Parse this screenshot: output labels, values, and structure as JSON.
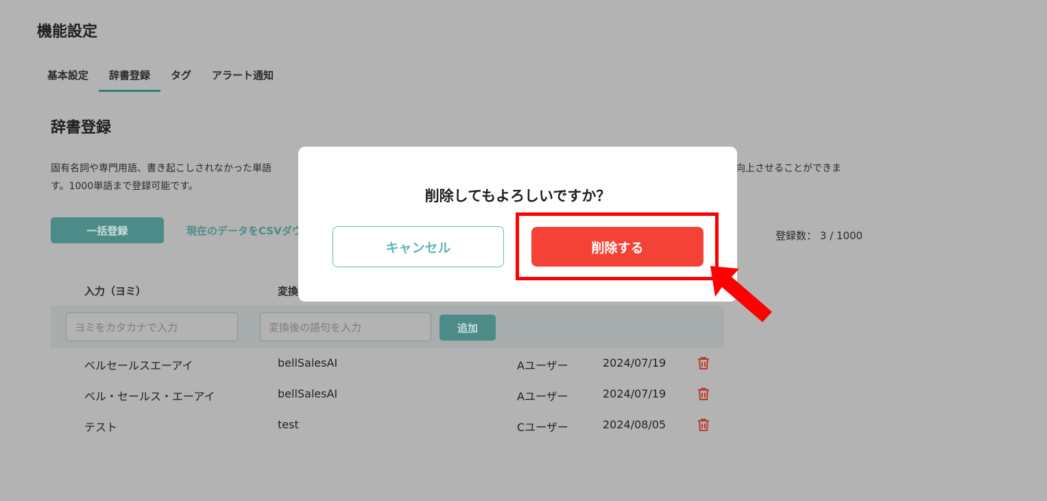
{
  "page": {
    "title": "機能設定"
  },
  "tabs": [
    {
      "label": "基本設定",
      "active": false
    },
    {
      "label": "辞書登録",
      "active": true
    },
    {
      "label": "タグ",
      "active": false
    },
    {
      "label": "アラート通知",
      "active": false
    }
  ],
  "section": {
    "title": "辞書登録",
    "description_line1_left": "固有名詞や専門用語、書き起こしされなかった単語",
    "description_line1_right": "向上させることができま",
    "description_line2": "す。1000単語まで登録可能です。"
  },
  "toolbar": {
    "bulk_label": "一括登録",
    "csv_label": "現在のデータをCSVダウ",
    "count_text": "登録数： 3 / 1000"
  },
  "table": {
    "headers": {
      "yomi": "入力（ヨミ）",
      "converted": "変換"
    },
    "input_row": {
      "yomi_placeholder": "ヨミをカタカナで入力",
      "converted_placeholder": "変換後の語句を入力",
      "add_label": "追加"
    },
    "rows": [
      {
        "yomi": "ベルセールスエーアイ",
        "converted": "bellSalesAI",
        "user": "Aユーザー",
        "date": "2024/07/19"
      },
      {
        "yomi": "ベル・セールス・エーアイ",
        "converted": "bellSalesAI",
        "user": "Aユーザー",
        "date": "2024/07/19"
      },
      {
        "yomi": "テスト",
        "converted": "test",
        "user": "Cユーザー",
        "date": "2024/08/05"
      }
    ]
  },
  "modal": {
    "title": "削除してもよろしいですか？",
    "cancel_label": "キャンセル",
    "delete_label": "削除する"
  },
  "icons": {
    "row_action": "trash-icon",
    "annotation": "red-arrow-icon"
  },
  "colors": {
    "accent": "#4d8b88",
    "cancel_outline": "#5fb8b2",
    "delete": "#f44336",
    "trash": "#c0392b",
    "annotation": "#ff0000"
  }
}
